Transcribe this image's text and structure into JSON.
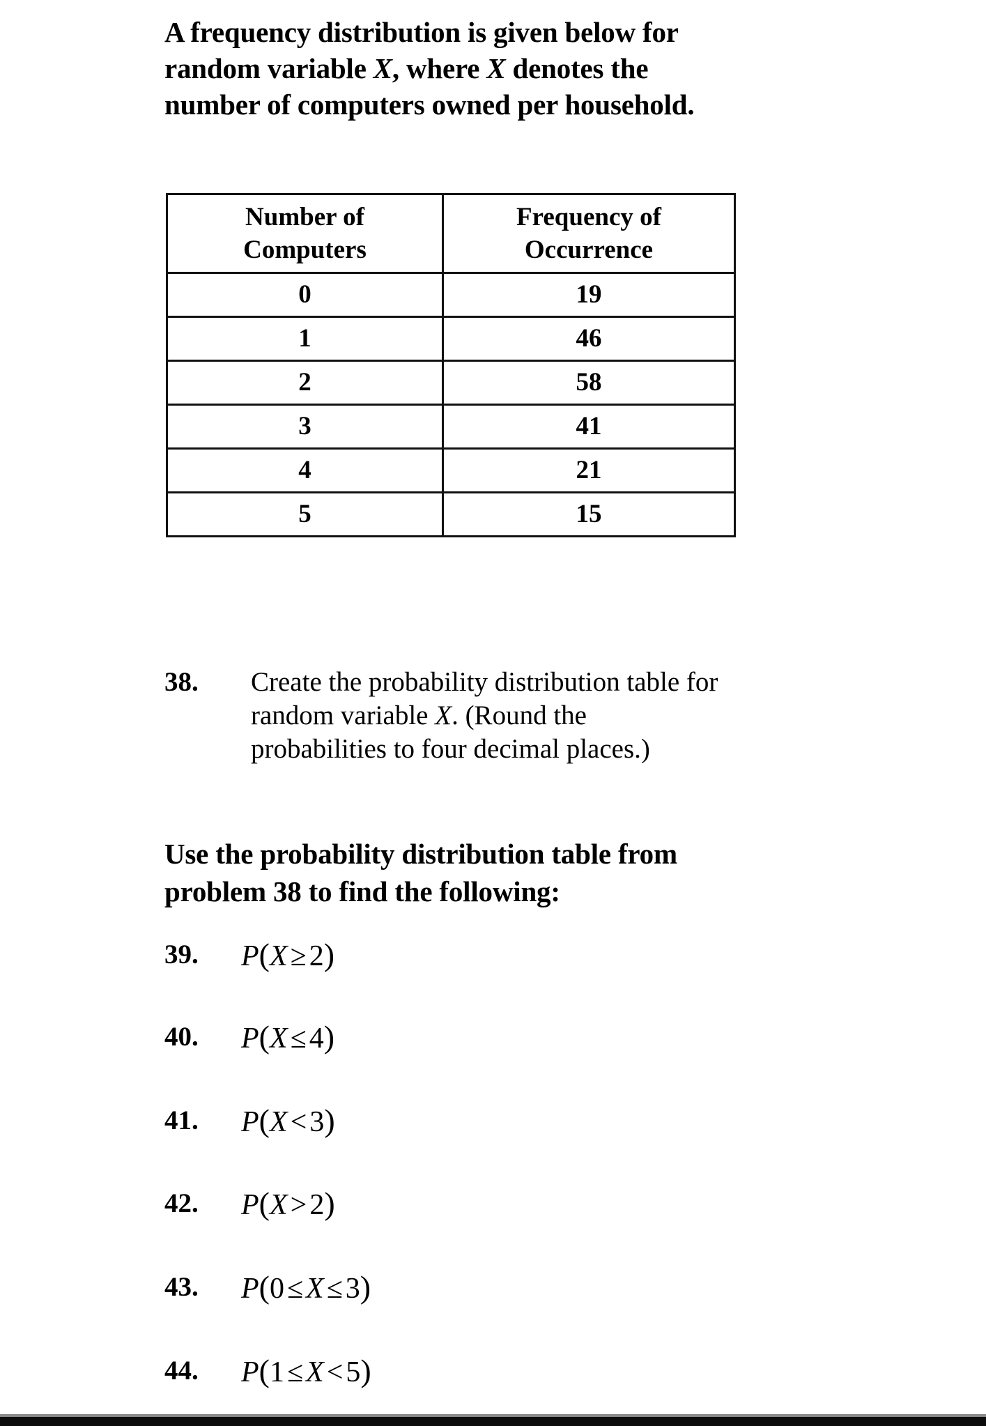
{
  "intro": {
    "line1_a": "A frequency distribution is given below for",
    "line2_a": "random variable ",
    "line2_var1": "X",
    "line2_b": ", where ",
    "line2_var2": "X",
    "line2_c": " denotes the",
    "line3_a": "number of computers owned per household."
  },
  "table": {
    "headers": [
      {
        "line1": "Number of",
        "line2": "Computers"
      },
      {
        "line1": "Frequency of",
        "line2": "Occurrence"
      }
    ],
    "rows": [
      {
        "x": "0",
        "f": "19"
      },
      {
        "x": "1",
        "f": "46"
      },
      {
        "x": "2",
        "f": "58"
      },
      {
        "x": "3",
        "f": "41"
      },
      {
        "x": "4",
        "f": "21"
      },
      {
        "x": "5",
        "f": "15"
      }
    ]
  },
  "problem38": {
    "number": "38.",
    "line1": "Create the probability distribution table for",
    "line2_a": "random variable ",
    "line2_var": "X",
    "line2_b": ". (Round the",
    "line3": "probabilities to four decimal places.)"
  },
  "instruction": {
    "line1": "Use the probability distribution table from",
    "line2": "problem 38 to find the following:"
  },
  "questions": [
    {
      "number": "39.",
      "p": "P",
      "open": "(",
      "left": "X",
      "op": "≥",
      "right": "2",
      "close": ")"
    },
    {
      "number": "40.",
      "p": "P",
      "open": "(",
      "left": "X",
      "op": "≤",
      "right": "4",
      "close": ")"
    },
    {
      "number": "41.",
      "p": "P",
      "open": "(",
      "left": "X",
      "op": "<",
      "right": "3",
      "close": ")"
    },
    {
      "number": "42.",
      "p": "P",
      "open": "(",
      "left": "X",
      "op": ">",
      "right": "2",
      "close": ")"
    },
    {
      "number": "43.",
      "p": "P",
      "open": "(",
      "lower": "0",
      "op1": "≤",
      "left": "X",
      "op": "≤",
      "right": "3",
      "close": ")"
    },
    {
      "number": "44.",
      "p": "P",
      "open": "(",
      "lower": "1",
      "op1": "≤",
      "left": "X",
      "op": "<",
      "right": "5",
      "close": ")"
    }
  ]
}
